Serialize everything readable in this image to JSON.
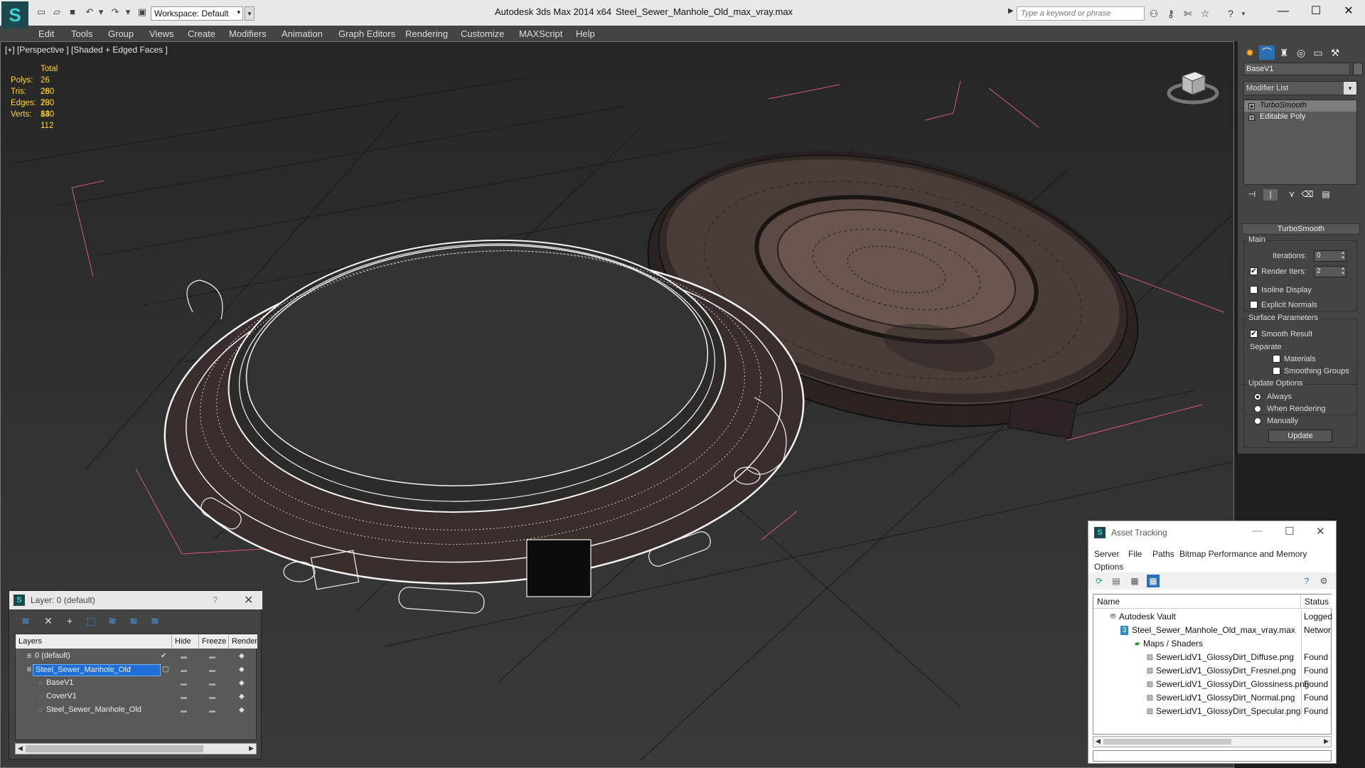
{
  "titlebar": {
    "app_title": "Autodesk 3ds Max  2014 x64",
    "file_title": "Steel_Sewer_Manhole_Old_max_vray.max",
    "workspace": "Workspace: Default",
    "search_placeholder": "Type a keyword or phrase",
    "logo_glyph": "S",
    "minimize_glyph": "—",
    "maximize_glyph": "☐",
    "close_glyph": "✕"
  },
  "menubar": [
    "Edit",
    "Tools",
    "Group",
    "Views",
    "Create",
    "Modifiers",
    "Animation",
    "Graph Editors",
    "Rendering",
    "Customize",
    "MAXScript",
    "Help"
  ],
  "viewport": {
    "label": "[+] [Perspective ] [Shaded + Edged Faces ]",
    "stats_header": "Total",
    "stats": [
      {
        "k": "Polys:",
        "v": "26 280"
      },
      {
        "k": "Tris:",
        "v": "26 280"
      },
      {
        "k": "Edges:",
        "v": "78 840"
      },
      {
        "k": "Verts:",
        "v": "13 112"
      }
    ]
  },
  "command_panel": {
    "object_name": "BaseV1",
    "modifier_list": "Modifier List",
    "stack": [
      {
        "label": "TurboSmooth",
        "selected": true
      },
      {
        "label": "Editable Poly",
        "selected": false
      }
    ],
    "turbosmooth": {
      "rollout_title": "TurboSmooth",
      "main_title": "Main",
      "iterations_label": "Iterations:",
      "iterations_value": "0",
      "render_iters_label": "Render Iters:",
      "render_iters_value": "2",
      "isoline_label": "Isoline Display",
      "explicit_label": "Explicit Normals",
      "surface_title": "Surface Parameters",
      "smooth_label": "Smooth Result",
      "separate_label": "Separate",
      "materials_label": "Materials",
      "smoothing_groups_label": "Smoothing Groups",
      "update_title": "Update Options",
      "always_label": "Always",
      "when_rendering_label": "When Rendering",
      "manually_label": "Manually",
      "update_button": "Update"
    }
  },
  "layer_window": {
    "title": "Layer: 0 (default)",
    "help_glyph": "?",
    "close_glyph": "✕",
    "headers": {
      "layers": "Layers",
      "hide": "Hide",
      "freeze": "Freeze",
      "render": "Render"
    },
    "rows": [
      {
        "name": "0 (default)",
        "indent": 1,
        "selected": false
      },
      {
        "name": "Steel_Sewer_Manhole_Old",
        "indent": 1,
        "selected": true
      },
      {
        "name": "BaseV1",
        "indent": 2,
        "selected": false
      },
      {
        "name": "CoverV1",
        "indent": 2,
        "selected": false
      },
      {
        "name": "Steel_Sewer_Manhole_Old",
        "indent": 2,
        "selected": false
      }
    ]
  },
  "asset_window": {
    "title": "Asset Tracking",
    "menus": [
      "Server",
      "File",
      "Paths",
      "Bitmap Performance and Memory"
    ],
    "options_menu": "Options",
    "headers": {
      "name": "Name",
      "status": "Status"
    },
    "rows": [
      {
        "name": "Autodesk Vault",
        "status": "Logged",
        "indent": 1
      },
      {
        "name": "Steel_Sewer_Manhole_Old_max_vray.max",
        "status": "Networ",
        "indent": 2
      },
      {
        "name": "Maps / Shaders",
        "status": "",
        "indent": 3
      },
      {
        "name": "SewerLidV1_GlossyDirt_Diffuse.png",
        "status": "Found",
        "indent": 4
      },
      {
        "name": "SewerLidV1_GlossyDirt_Fresnel.png",
        "status": "Found",
        "indent": 4
      },
      {
        "name": "SewerLidV1_GlossyDirt_Glossiness.png",
        "status": "Found",
        "indent": 4
      },
      {
        "name": "SewerLidV1_GlossyDirt_Normal.png",
        "status": "Found",
        "indent": 4
      },
      {
        "name": "SewerLidV1_GlossyDirt_Specular.png",
        "status": "Found",
        "indent": 4
      }
    ]
  },
  "colors": {
    "stats": "#ffd83a",
    "selection": "#1f6fd6",
    "grid": "#d85a78"
  }
}
